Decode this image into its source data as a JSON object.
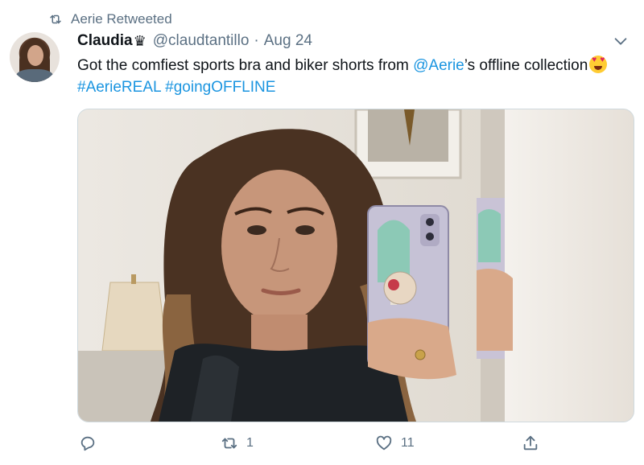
{
  "retweet_banner": {
    "icon": "retweet-icon",
    "text": "Aerie Retweeted"
  },
  "tweet": {
    "author_name": "Claudia",
    "author_badge": "♛",
    "handle": "@claudtantillo",
    "separator": "·",
    "date": "Aug 24",
    "text_part1": "Got the comfiest sports bra and biker shorts from ",
    "mention": "@Aerie",
    "text_part2": "’s offline collection",
    "emoji": "heart-eyes-emoji",
    "hashtag1": "#AerieREAL",
    "hashtag2": "#goingOFFLINE",
    "photo": "mirror-selfie-photo"
  },
  "actions": {
    "reply_count": "",
    "retweet_count": "1",
    "like_count": "11",
    "share_count": ""
  },
  "colors": {
    "accent": "#1b95e0",
    "muted": "#5b7083",
    "text": "#0f1419"
  }
}
